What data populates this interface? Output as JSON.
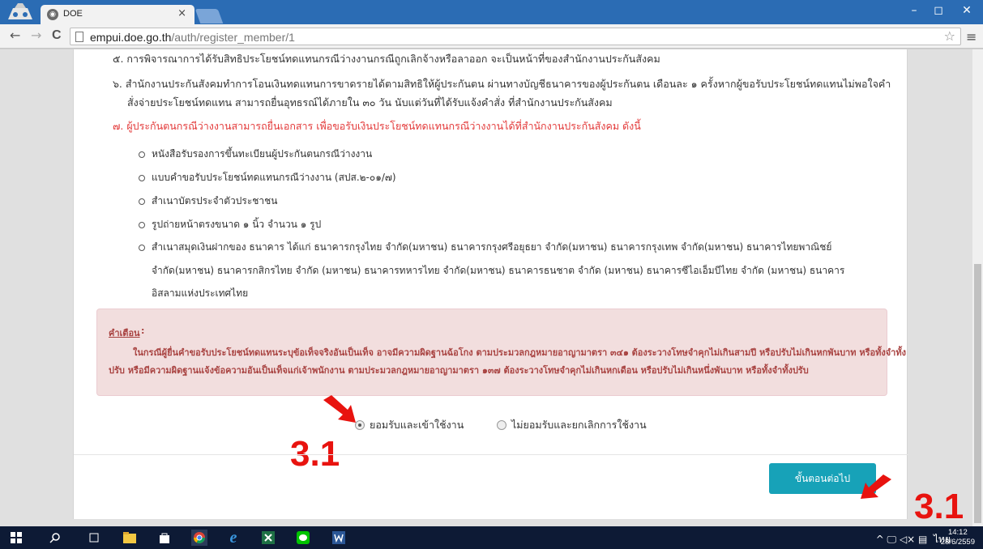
{
  "browser": {
    "tab_title": "DOE",
    "tab_close": "×",
    "favicon_glyph": "◉",
    "url_host": "empui.doe.go.th",
    "url_path": "/auth/register_member/1",
    "back": "←",
    "forward": "→",
    "reload": "C",
    "star": "☆",
    "menu": "≡",
    "minimize": "–",
    "maximize": "◻",
    "close": "✕"
  },
  "content": {
    "item5": "๕. การพิจารณาการได้รับสิทธิประโยชน์ทดแทนกรณีว่างงานกรณีถูกเลิกจ้างหรือลาออก จะเป็นหน้าที่ของสำนักงานประกันสังคม",
    "item6_line1": "๖. สำนักงานประกันสังคมทำการโอนเงินทดแทนการขาดรายได้ตามสิทธิให้ผู้ประกันตน ผ่านทางบัญชีธนาคารของผู้ประกันตน เดือนละ ๑ ครั้งหากผู้ขอรับประโยชน์ทดแทนไม่พอใจคำ",
    "item6_line2": "สั่งจ่ายประโยชน์ทดแทน สามารถยื่นอุทธรณ์ได้ภายใน ๓๐ วัน นับแต่วันที่ได้รับแจ้งคำสั่ง ที่สำนักงานประกันสังคม",
    "item7": "๗. ผู้ประกันตนกรณีว่างงานสามารถยื่นเอกสาร เพื่อขอรับเงินประโยชน์ทดแทนกรณีว่างงานได้ที่สำนักงานประกันสังคม ดังนี้",
    "docs": [
      "หนังสือรับรองการขึ้นทะเบียนผู้ประกันตนกรณีว่างงาน",
      "แบบคำขอรับประโยชน์ทดแทนกรณีว่างงาน (สปส.๒-๐๑/๗)",
      "สำเนาบัตรประจำตัวประชาชน",
      "รูปถ่ายหน้าตรงขนาด ๑ นิ้ว จำนวน ๑ รูป",
      "สำเนาสมุดเงินฝากของ ธนาคาร ได้แก่ ธนาคารกรุงไทย จำกัด(มหาชน) ธนาคารกรุงศรีอยุธยา จำกัด(มหาชน)  ธนาคารกรุงเทพ จำกัด(มหาชน) ธนาคารไทยพาณิชย์"
    ],
    "doc5_line2": "จำกัด(มหาชน) ธนาคารกสิกรไทย จำกัด (มหาชน)  ธนาคารทหารไทย จำกัด(มหาชน) ธนาคารธนชาต จำกัด (มหาชน)  ธนาคารซีไอเอ็มบีไทย จำกัด (มหาชน)  ธนาคาร",
    "doc5_line3": "อิสลามแห่งประเทศไทย"
  },
  "warning": {
    "title": "คำเตือน",
    "colon": ":",
    "line1": "ในกรณีผู้ยื่นคำขอรับประโยชน์ทดแทนระบุข้อเท็จจริงอันเป็นเท็จ อาจมีความผิดฐานฉ้อโกง ตามประมวลกฎหมายอาญามาตรา ๓๔๑ ต้องระวางโทษจำคุกไม่เกินสามปี หรือปรับไม่เกินหกพันบาท หรือทั้งจำทั้ง",
    "line2": "ปรับ หรือมีความผิดฐานแจ้งข้อความอันเป็นเท็จแก่เจ้าพนักงาน ตามประมวลกฎหมายอาญามาตรา ๑๓๗ ต้องระวางโทษจำคุกไม่เกินหกเดือน หรือปรับไม่เกินหนึ่งพันบาท หรือทั้งจำทั้งปรับ"
  },
  "consent": {
    "accept_label": "ยอมรับและเข้าใช้งาน",
    "reject_label": "ไม่ยอมรับและยกเลิกการใช้งาน",
    "selected": "accept"
  },
  "actions": {
    "next_label": "ขั้นตอนต่อไป"
  },
  "annotations": {
    "label1": "3.1",
    "label2": "3.1",
    "arrow_color": "#e8130f"
  },
  "taskbar": {
    "tray_text": "^ 🖵 ◁× ▤",
    "lang": "ไทย",
    "time": "14:12",
    "date": "28/6/2559"
  }
}
